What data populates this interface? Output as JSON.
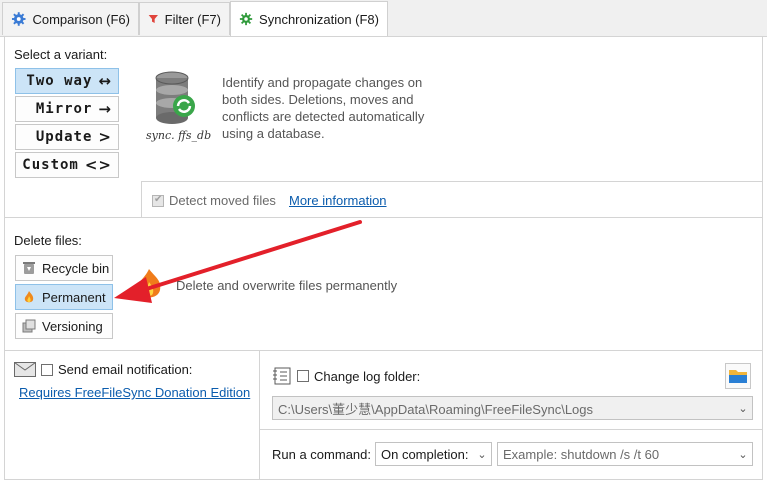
{
  "tabs": [
    {
      "label": "Comparison (F6)",
      "icon": "gear-icon"
    },
    {
      "label": "Filter (F7)",
      "icon": "filter-icon"
    },
    {
      "label": "Synchronization (F8)",
      "icon": "gear-icon"
    }
  ],
  "variants": {
    "label": "Select a variant:",
    "items": [
      {
        "label": "Two way",
        "glyph": "↔",
        "selected": true
      },
      {
        "label": "Mirror",
        "glyph": "→",
        "selected": false
      },
      {
        "label": "Update",
        "glyph": ">",
        "selected": false
      },
      {
        "label": "Custom",
        "glyph": "<>",
        "selected": false
      }
    ],
    "db_caption": "sync. ffs_db",
    "description": [
      "Identify and propagate changes on",
      "both sides. Deletions, moves and",
      "conflicts are detected automatically",
      "using a database."
    ]
  },
  "detect_moved": {
    "label": "Detect moved files",
    "link": "More information"
  },
  "delete_files": {
    "label": "Delete files:",
    "items": [
      {
        "label": "Recycle bin",
        "icon": "recycle-bin-icon",
        "selected": false
      },
      {
        "label": "Permanent",
        "icon": "flame-icon",
        "selected": true
      },
      {
        "label": "Versioning",
        "icon": "versioning-icon",
        "selected": false
      }
    ],
    "description": "Delete and overwrite files permanently"
  },
  "email": {
    "label": "Send email notification:",
    "link": "Requires FreeFileSync Donation Edition"
  },
  "log": {
    "label": "Change log folder:",
    "path": "C:\\Users\\董少慧\\AppData\\Roaming\\FreeFileSync\\Logs"
  },
  "command": {
    "label": "Run a command:",
    "when": "On completion:",
    "placeholder": "Example: shutdown /s /t 60"
  },
  "colors": {
    "accent": "#cce4f7",
    "arrow": "#e3202a",
    "link": "#0b5cad"
  }
}
